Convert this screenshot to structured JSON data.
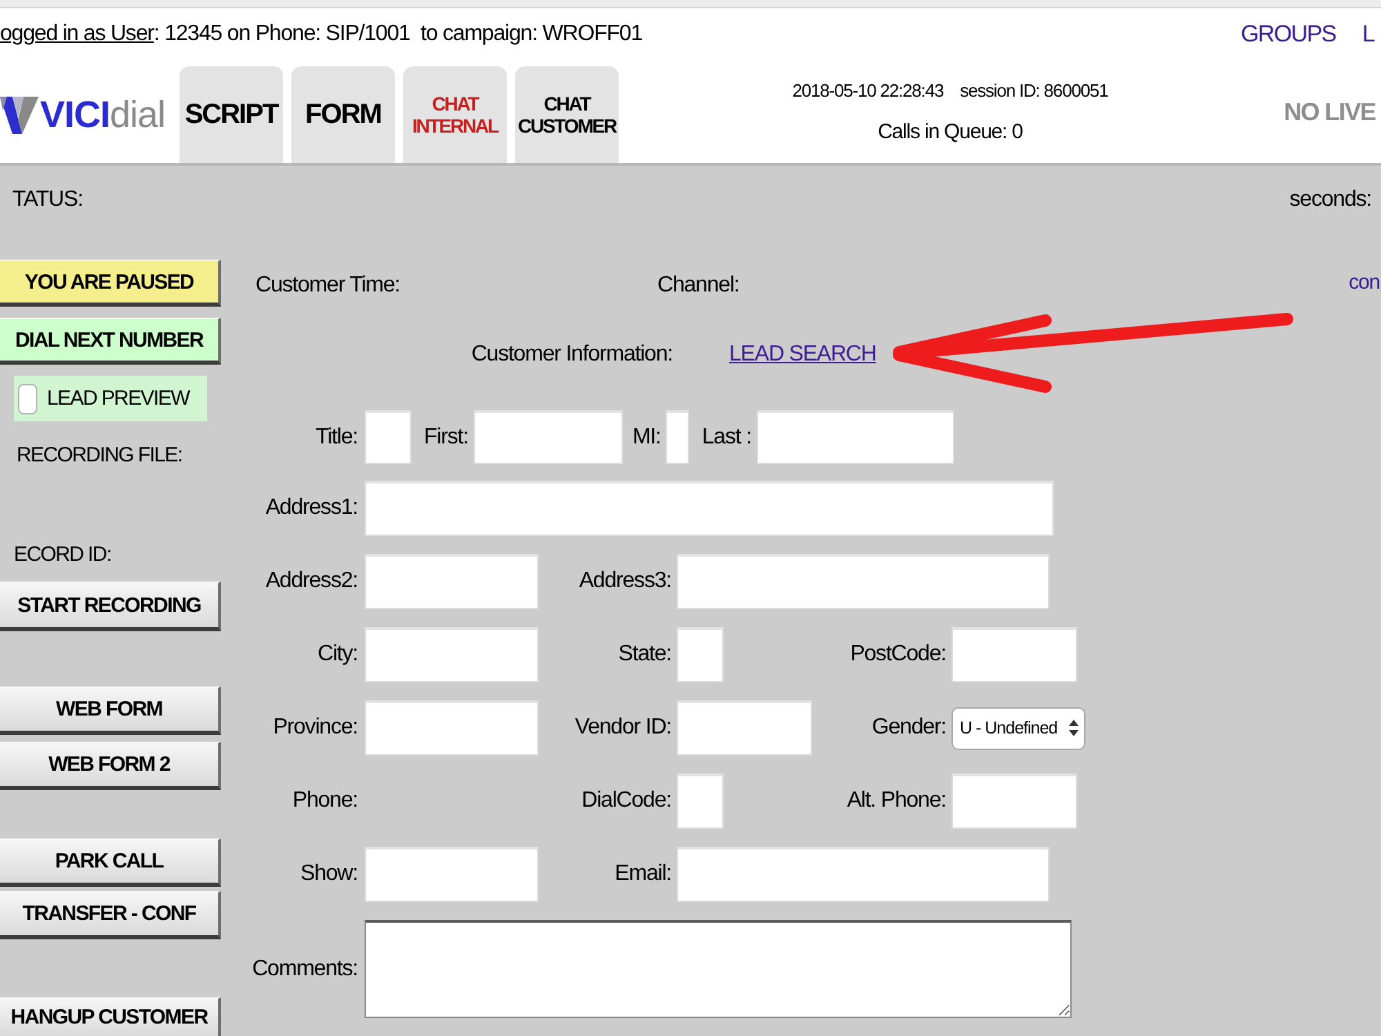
{
  "session": {
    "user_link": "ogged in as User",
    "login_text": ": 12345 on Phone: SIP/1001  to campaign: WROFF01"
  },
  "nav_links": [
    "GROUPS",
    "L"
  ],
  "logo": {
    "text": "**VICI**dial"
  },
  "tabs": [
    {
      "lines": [
        "SCRIPT"
      ],
      "color": "#000000",
      "selected": false
    },
    {
      "lines": [
        "FORM"
      ],
      "color": "#000000",
      "selected": false
    },
    {
      "lines": [
        "CHAT",
        "INTERNAL"
      ],
      "color": "#c81e1e",
      "selected": false
    },
    {
      "lines": [
        "CHAT",
        "CUSTOMER"
      ],
      "color": "#000000",
      "selected": false
    }
  ],
  "call_info": {
    "datetime": "2018-05-10 22:28:43",
    "session_id": "session ID: 8600051",
    "queue": "Calls in Queue: 0"
  },
  "live_status": "NO LIVE",
  "status_bar": {
    "status_label": "TATUS:",
    "seconds_label": "seconds:"
  },
  "left_panel": {
    "status_buttons": [
      {
        "label": "YOU ARE PAUSED",
        "color": "#f4ef8c"
      },
      {
        "label": "DIAL NEXT NUMBER",
        "color": "#ccffcc"
      }
    ],
    "lead_preview": {
      "label": "LEAD PREVIEW",
      "checked": false
    },
    "recording_file_label": "RECORDING FILE:",
    "record_id_label": "ECORD ID:",
    "recording_buttons": [
      "START RECORDING"
    ],
    "web_form_buttons": [
      "WEB FORM",
      "WEB FORM 2"
    ],
    "call_buttons": [
      "PARK CALL",
      "TRANSFER - CONF"
    ],
    "hangup_button": "HANGUP CUSTOMER"
  },
  "customer": {
    "time_label": "Customer Time:",
    "channel_label": "Channel:",
    "info_label": "Customer Information:",
    "lead_search_link": "LEAD SEARCH"
  },
  "form": {
    "name_fields": [
      {
        "label": "Title:"
      },
      {
        "label": "First:"
      },
      {
        "label": "MI:"
      },
      {
        "label": "Last :"
      }
    ],
    "rows": [
      {
        "fields": [
          {
            "label": "Address1:",
            "kind": "input"
          }
        ]
      },
      {
        "fields": [
          {
            "label": "Address2:",
            "kind": "input"
          },
          {
            "label": "Address3:",
            "kind": "input"
          }
        ]
      },
      {
        "fields": [
          {
            "label": "City:",
            "kind": "input"
          },
          {
            "label": "State:",
            "kind": "input"
          },
          {
            "label": "PostCode:",
            "kind": "input"
          }
        ]
      },
      {
        "fields": [
          {
            "label": "Province:",
            "kind": "input"
          },
          {
            "label": "Vendor ID:",
            "kind": "input"
          },
          {
            "label": "Gender:",
            "kind": "select",
            "value": "U - Undefined"
          }
        ]
      },
      {
        "fields": [
          {
            "label": "Phone:",
            "kind": "static"
          },
          {
            "label": "DialCode:",
            "kind": "input"
          },
          {
            "label": "Alt. Phone:",
            "kind": "input"
          }
        ]
      },
      {
        "fields": [
          {
            "label": "Show:",
            "kind": "input"
          },
          {
            "label": "Email:",
            "kind": "input"
          }
        ]
      },
      {
        "fields": [
          {
            "label": "Comments:",
            "kind": "textarea"
          }
        ]
      }
    ]
  },
  "side_link": "con"
}
